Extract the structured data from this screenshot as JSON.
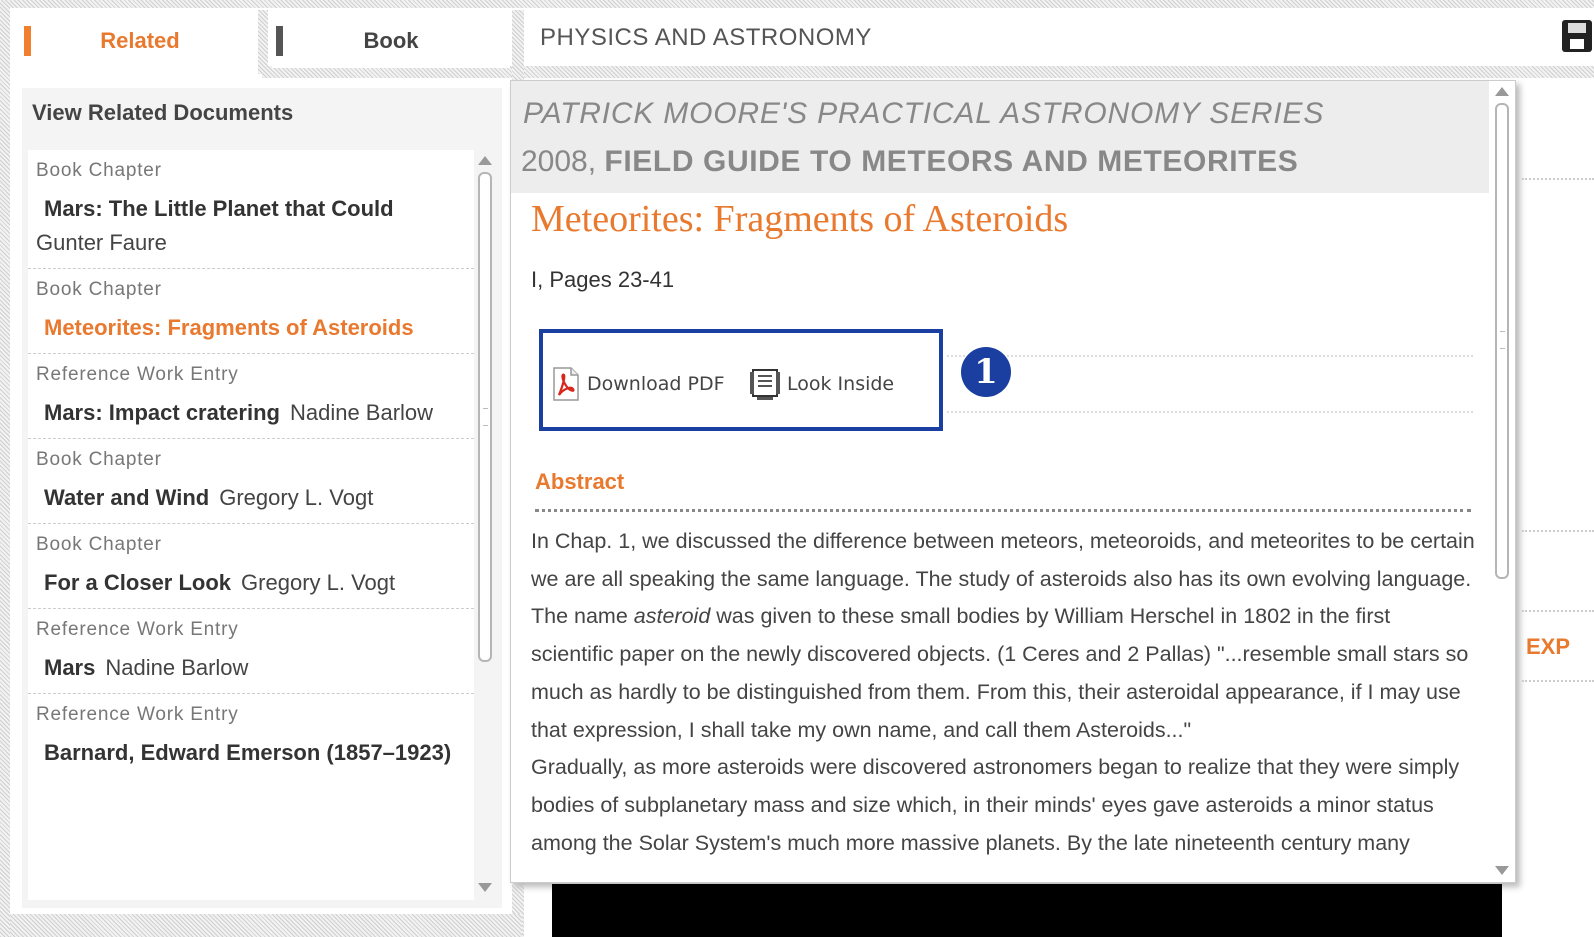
{
  "tabs": {
    "related_label": "Related",
    "book_label": "Book"
  },
  "header": {
    "title": "PHYSICS AND ASTRONOMY",
    "save_icon": "floppy-disk-icon"
  },
  "left_panel": {
    "heading": "View Related Documents",
    "items": [
      {
        "type": "Book Chapter",
        "title": "Mars: The Little Planet that Could",
        "author": "Gunter Faure"
      },
      {
        "type": "Book Chapter",
        "title": "Meteorites: Fragments of Asteroids",
        "author": ""
      },
      {
        "type": "Reference Work Entry",
        "title": "Mars: Impact cratering",
        "author": "Nadine Barlow"
      },
      {
        "type": "Book Chapter",
        "title": "Water and Wind",
        "author": "Gregory L. Vogt"
      },
      {
        "type": "Book Chapter",
        "title": "For a Closer Look",
        "author": "Gregory L. Vogt"
      },
      {
        "type": "Reference Work Entry",
        "title": "Mars",
        "author": "Nadine Barlow"
      },
      {
        "type": "Reference Work Entry",
        "title": "Barnard, Edward Emerson (1857–1923)",
        "author": ""
      }
    ]
  },
  "detail": {
    "series": "PATRICK MOORE'S PRACTICAL ASTRONOMY SERIES",
    "year": "2008,",
    "book_title": "FIELD GUIDE TO METEORS AND METEORITES",
    "chapter_title": "Meteorites: Fragments of Asteroids",
    "pages": "I, Pages 23-41",
    "download_label": "Download PDF",
    "look_inside_label": "Look Inside",
    "marker": "1",
    "abstract_heading": "Abstract",
    "abstract_part1": "In Chap. 1, we discussed the difference between meteors, meteoroids, and meteorites to be certain we are all speaking the same language. The study of asteroids also has its own evolving language. The name ",
    "abstract_italic": "asteroid",
    "abstract_part2": " was given to these small bodies by William Herschel in 1802 in the first scientific paper on the newly discovered objects. (1 Ceres and 2 Pallas) \"...resemble small stars so much as hardly to be distinguished from them. From this, their asteroidal appearance, if I may use that expression, I shall take my own name, and call them Asteroids...\"",
    "abstract_para2": "Gradually, as more asteroids were discovered astronomers began to realize that they were simply bodies of subplanetary mass and size which, in their minds' eyes gave asteroids a minor status among the Solar System's much more massive planets. By the late nineteenth century many"
  },
  "background": {
    "edge_label": "EXP"
  },
  "colors": {
    "accent": "#e8792e",
    "highlight_box": "#1a3fa0"
  }
}
